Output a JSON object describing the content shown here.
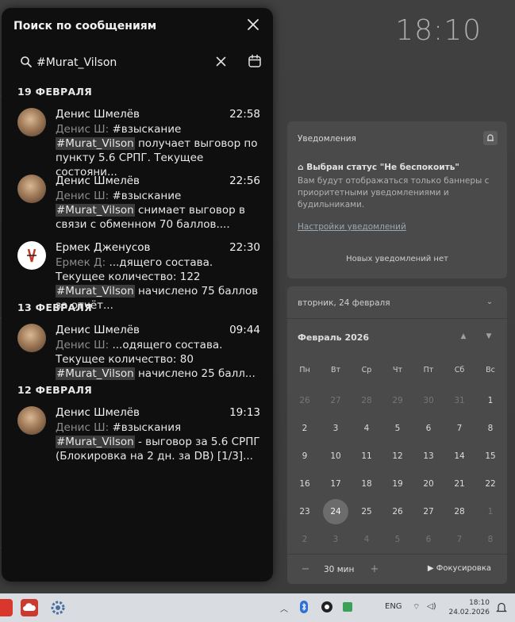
{
  "desktop": {
    "clock": "18:10"
  },
  "search_panel": {
    "title": "Поиск по сообщениям",
    "query": "#Murat_Vilson",
    "groups": [
      {
        "date": "19 ФЕВРАЛЯ",
        "results": [
          {
            "name": "Денис Шмелёв",
            "time": "22:58",
            "sender": "Денис Ш:",
            "line1": "#взыскание",
            "hl": "#Murat_Vilson",
            "rest": "получает выговор по пункту 5.6 СРПГ. Текущее состояни..."
          },
          {
            "name": "Денис Шмелёв",
            "time": "22:56",
            "sender": "Денис Ш:",
            "line1": "#взыскание",
            "hl": "#Murat_Vilson",
            "rest": "снимает выговор в связи с обменном 70 баллов...."
          },
          {
            "name": "Ермек Дженусов",
            "time": "22:30",
            "sender": "Ермек Д:",
            "line1": "...дящего состава. Текущее количество: 122",
            "hl": "#Murat_Vilson",
            "rest": "начислено 75 баллов за отчёт..."
          }
        ]
      },
      {
        "date": "13 ФЕВРАЛЯ",
        "results": [
          {
            "name": "Денис Шмелёв",
            "time": "09:44",
            "sender": "Денис Ш:",
            "line1": "...одящего состава. Текущее количество: 80",
            "hl": "#Murat_Vilson",
            "rest": "начислено 25 балл..."
          }
        ]
      },
      {
        "date": "12 ФЕВРАЛЯ",
        "results": [
          {
            "name": "Денис Шмелёв",
            "time": "19:13",
            "sender": "Денис Ш:",
            "line1": "#взыскания",
            "hl": "#Murat_Vilson",
            "rest": "- выговор за 5.6 СРПГ (Блокировка на 2 дн. за DB) [1/3]..."
          }
        ]
      }
    ]
  },
  "notifications": {
    "title": "Уведомления",
    "status": "Выбран статус \"Не беспокоить\"",
    "description": "Вам будут отображаться только баннеры с приоритетными уведомлениями и будильниками.",
    "settings_link": "Настройки уведомлений",
    "empty": "Новых уведомлений нет"
  },
  "calendar": {
    "current_date": "вторник, 24 февраля",
    "month": "Февраль 2026",
    "weekdays": [
      "Пн",
      "Вт",
      "Ср",
      "Чт",
      "Пт",
      "Сб",
      "Вс"
    ],
    "days": [
      "26",
      "27",
      "28",
      "29",
      "30",
      "31",
      "1",
      "2",
      "3",
      "4",
      "5",
      "6",
      "7",
      "8",
      "9",
      "10",
      "11",
      "12",
      "13",
      "14",
      "15",
      "16",
      "17",
      "18",
      "19",
      "20",
      "21",
      "22",
      "23",
      "24",
      "25",
      "26",
      "27",
      "28",
      "1",
      "2",
      "3",
      "4",
      "5",
      "6",
      "7",
      "8"
    ],
    "today": "24",
    "focus_minutes": "30 мин",
    "focus_label": "Фокусировка"
  },
  "taskbar": {
    "lang": "ENG",
    "time": "18:10",
    "date": "24.02.2026"
  }
}
